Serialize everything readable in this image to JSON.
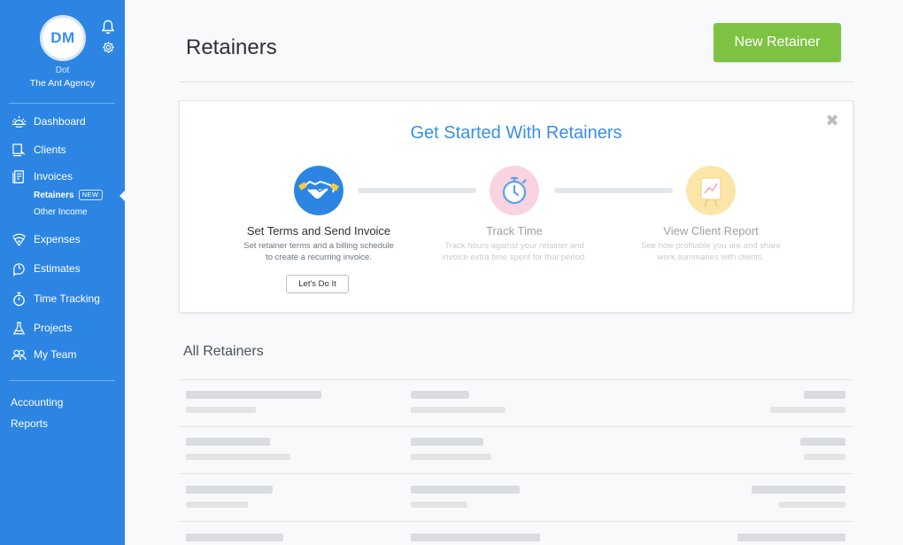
{
  "user": {
    "initials": "DM",
    "name": "Dot",
    "agency": "The Ant Agency"
  },
  "sidebar": {
    "nav": [
      {
        "label": "Dashboard",
        "icon": "dashboard-sun-icon"
      },
      {
        "label": "Clients",
        "icon": "clients-icon"
      },
      {
        "label": "Invoices",
        "icon": "invoices-icon"
      },
      {
        "label": "Expenses",
        "icon": "expenses-icon"
      },
      {
        "label": "Estimates",
        "icon": "estimates-icon"
      },
      {
        "label": "Time Tracking",
        "icon": "stopwatch-icon"
      },
      {
        "label": "Projects",
        "icon": "flask-icon"
      },
      {
        "label": "My Team",
        "icon": "team-icon"
      }
    ],
    "invoice_sub": [
      {
        "label": "Retainers",
        "badge": "NEW",
        "active": true
      },
      {
        "label": "Other Income"
      }
    ],
    "bottom_links": [
      "Accounting",
      "Reports"
    ],
    "accent": "#2c85e3"
  },
  "page": {
    "title": "Retainers",
    "new_button": "New Retainer",
    "new_button_color": "#7dc243"
  },
  "onboarding": {
    "title": "Get Started With Retainers",
    "close_glyph": "✖",
    "steps": [
      {
        "title": "Set Terms and Send Invoice",
        "desc_line1": "Set retainer terms and a billing schedule",
        "desc_line2": "to create a recurring invoice.",
        "icon": "handshake-icon",
        "button": "Let's Do It"
      },
      {
        "title": "Track Time",
        "desc_line1": "Track hours against your retainer and",
        "desc_line2": "invoice extra time spent for that period.",
        "icon": "stopwatch-icon"
      },
      {
        "title": "View Client Report",
        "desc_line1": "See how profitable you are and share",
        "desc_line2": "work summaries with clients.",
        "icon": "report-chart-icon"
      }
    ]
  },
  "list": {
    "title": "All Retainers"
  }
}
